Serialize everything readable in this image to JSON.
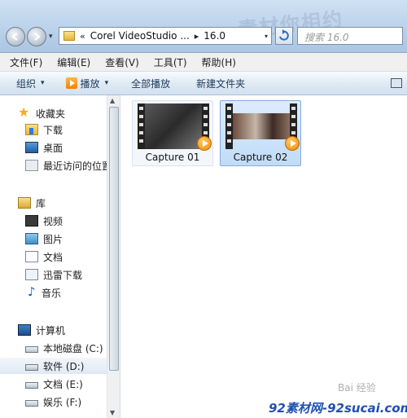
{
  "window": {
    "watermark_text": "素材你相约",
    "address": {
      "recent_glyph": "▾",
      "breadcrumb_prefix": "«",
      "breadcrumb": [
        "Corel VideoStudio ...",
        "16.0"
      ],
      "separator": "▸",
      "dropdown_glyph": "▾"
    },
    "search": {
      "placeholder": "搜索 16.0"
    }
  },
  "menubar": {
    "items": [
      "文件(F)",
      "编辑(E)",
      "查看(V)",
      "工具(T)",
      "帮助(H)"
    ]
  },
  "toolbar": {
    "organize_label": "组织",
    "play_label": "播放",
    "play_all_label": "全部播放",
    "new_folder_label": "新建文件夹",
    "caret": "▾"
  },
  "navpane": {
    "favorites": {
      "label": "收藏夹",
      "items": [
        "下载",
        "桌面",
        "最近访问的位置"
      ]
    },
    "libraries": {
      "label": "库",
      "items": [
        "视频",
        "图片",
        "文档",
        "迅雷下载",
        "音乐"
      ]
    },
    "computer": {
      "label": "计算机",
      "drives": [
        "本地磁盘 (C:)",
        "软件 (D:)",
        "文档 (E:)",
        "娱乐 (F:)"
      ],
      "selected_index": 1
    }
  },
  "content": {
    "files": [
      {
        "name": "Capture 01",
        "state": "hover"
      },
      {
        "name": "Capture 02",
        "state": "selected"
      }
    ]
  },
  "watermarks": {
    "baidu": "Bai 经验",
    "footer": "92素材网-92sucai.com"
  },
  "colors": {
    "selection_border": "#84acdd",
    "selection_fill": "#c1dcf8",
    "toolbar_text": "#1e395b"
  }
}
